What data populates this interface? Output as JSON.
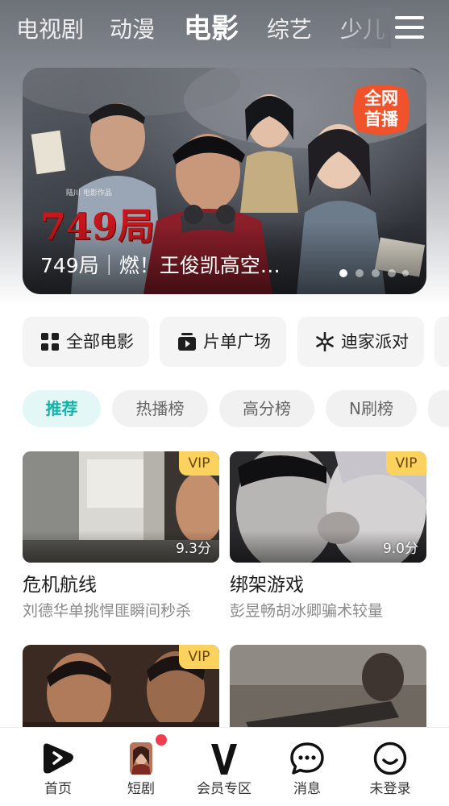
{
  "header": {
    "categories": [
      {
        "label": "电视剧",
        "active": false
      },
      {
        "label": "动漫",
        "active": false
      },
      {
        "label": "电影",
        "active": true
      },
      {
        "label": "综艺",
        "active": false
      },
      {
        "label": "少儿",
        "active": false
      }
    ],
    "menu_icon": "hamburger-menu-icon"
  },
  "banner": {
    "poster_title": "749局",
    "poster_credit": "陆川 电影作品",
    "badge_line1": "全网",
    "badge_line2": "首播",
    "caption": "749局｜燃！王俊凯高空…",
    "dot_count": 5,
    "active_dot": 1
  },
  "quick_entries": [
    {
      "label": "全部电影",
      "icon": "grid-icon"
    },
    {
      "label": "片单广场",
      "icon": "playlist-icon"
    },
    {
      "label": "迪家派对",
      "icon": "snowflake-icon"
    }
  ],
  "filters": [
    {
      "label": "推荐",
      "active": true
    },
    {
      "label": "热播榜",
      "active": false
    },
    {
      "label": "高分榜",
      "active": false
    },
    {
      "label": "N刷榜",
      "active": false
    }
  ],
  "movies": [
    {
      "title": "危机航线",
      "subtitle": "刘德华单挑悍匪瞬间秒杀",
      "badge": "VIP",
      "score": "9.3分"
    },
    {
      "title": "绑架游戏",
      "subtitle": "彭昱畅胡冰卿骗术较量",
      "badge": "VIP",
      "score": "9.0分"
    },
    {
      "title": "",
      "subtitle": "",
      "badge": "VIP",
      "score": ""
    },
    {
      "title": "",
      "subtitle": "",
      "badge": "",
      "score": ""
    }
  ],
  "tabbar": [
    {
      "label": "首页",
      "icon": "play-logo-icon"
    },
    {
      "label": "短剧",
      "icon": "short-drama-thumbnail-icon"
    },
    {
      "label": "会员专区",
      "icon": "vip-v-icon"
    },
    {
      "label": "消息",
      "icon": "message-bubble-icon"
    },
    {
      "label": "未登录",
      "icon": "user-smile-icon"
    }
  ],
  "colors": {
    "accent_teal": "#14b3a8",
    "vip_gold": "#fbd25e",
    "banner_title_red": "#c9161c",
    "badge_orange": "#f0522c",
    "notification_red": "#f23b4c"
  }
}
